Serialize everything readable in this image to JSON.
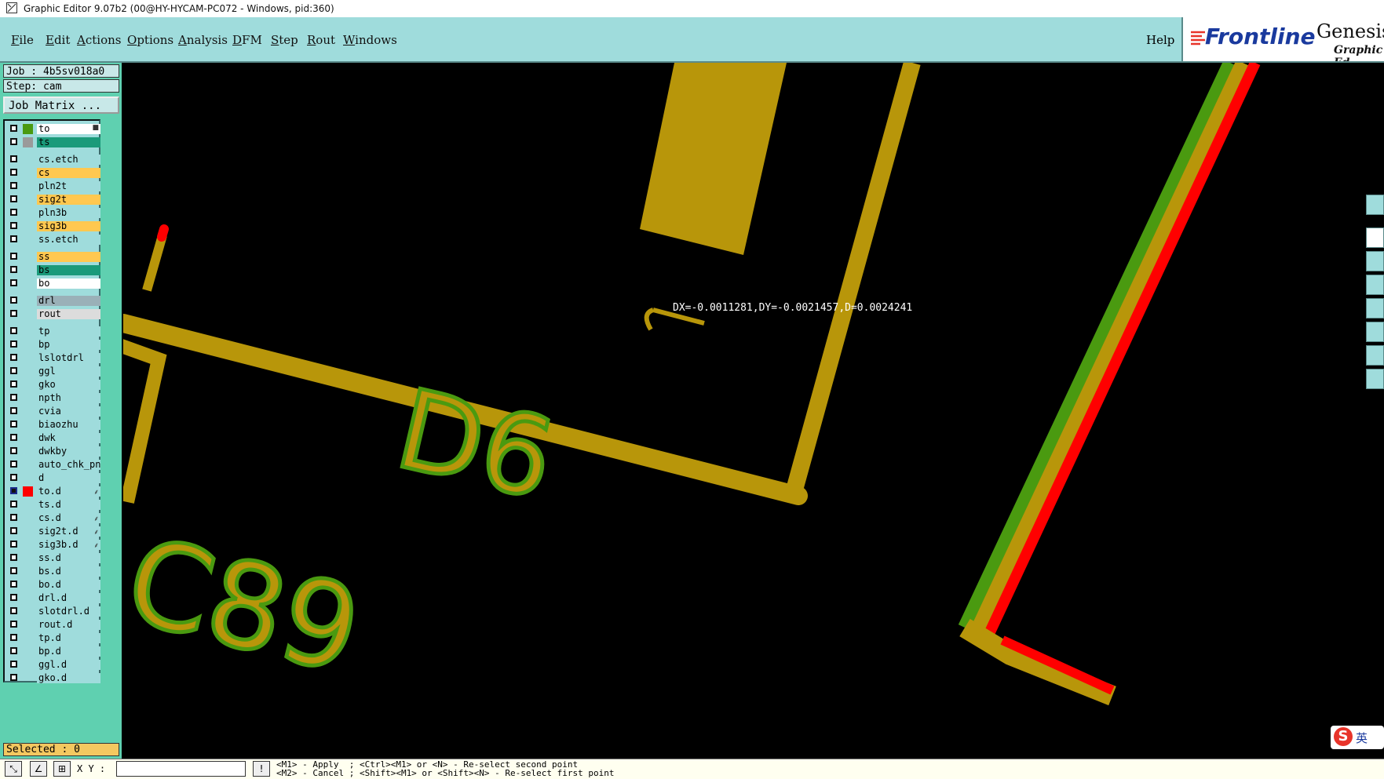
{
  "window": {
    "title": "Graphic Editor 9.07b2 (00@HY-HYCAM-PC072 - Windows, pid:360)"
  },
  "menu": {
    "file": "File",
    "edit": "Edit",
    "actions": "Actions",
    "options": "Options",
    "analysis": "Analysis",
    "dfm": "DFM",
    "step": "Step",
    "rout": "Rout",
    "windows": "Windows",
    "help": "Help"
  },
  "brand": {
    "logo": "Frontline",
    "product": "Genesis",
    "subtitle": "Graphic Ed"
  },
  "job": {
    "job_label": "Job : 4b5sv018a0",
    "step_label": "Step: cam",
    "matrix_button": "Job Matrix ..."
  },
  "colors": {
    "copper": "#b8960a",
    "silk_fill": "#b8960a",
    "silk_edge": "#4a9a10",
    "green_line": "#4a9a10",
    "red_line": "#ff0000",
    "panel": "#5fd0b0",
    "menubar": "#9fdcdc"
  },
  "layers": [
    {
      "name": "to",
      "color": "#4a9a10",
      "bg": "#ffffff",
      "checked": false,
      "mark": "■"
    },
    {
      "name": "ts",
      "color": "#9a9a9a",
      "bg": "#1a9a7a",
      "checked": false,
      "mark": ""
    },
    {
      "name": "cs.etch",
      "color": "",
      "bg": "#9fdcdc",
      "checked": false,
      "mark": "",
      "gap": true
    },
    {
      "name": "cs",
      "color": "",
      "bg": "#ffc850",
      "checked": false,
      "mark": ""
    },
    {
      "name": "pln2t",
      "color": "",
      "bg": "#9fdcdc",
      "checked": false,
      "mark": ""
    },
    {
      "name": "sig2t",
      "color": "",
      "bg": "#ffc850",
      "checked": false,
      "mark": ""
    },
    {
      "name": "pln3b",
      "color": "",
      "bg": "#9fdcdc",
      "checked": false,
      "mark": ""
    },
    {
      "name": "sig3b",
      "color": "",
      "bg": "#ffc850",
      "checked": false,
      "mark": ""
    },
    {
      "name": "ss.etch",
      "color": "",
      "bg": "#9fdcdc",
      "checked": false,
      "mark": ""
    },
    {
      "name": "ss",
      "color": "",
      "bg": "#ffc850",
      "checked": false,
      "mark": "",
      "gap": true
    },
    {
      "name": "bs",
      "color": "",
      "bg": "#1a9a7a",
      "checked": false,
      "mark": ""
    },
    {
      "name": "bo",
      "color": "",
      "bg": "#ffffff",
      "checked": false,
      "mark": ""
    },
    {
      "name": "drl",
      "color": "",
      "bg": "#9ab0b8",
      "checked": false,
      "mark": "",
      "gap": true
    },
    {
      "name": "rout",
      "color": "",
      "bg": "#dcdcdc",
      "checked": false,
      "mark": ""
    },
    {
      "name": "tp",
      "color": "",
      "bg": "#9fdcdc",
      "checked": false,
      "mark": "",
      "gap": true
    },
    {
      "name": "bp",
      "color": "",
      "bg": "#9fdcdc",
      "checked": false,
      "mark": ""
    },
    {
      "name": "lslotdrl",
      "color": "",
      "bg": "#9fdcdc",
      "checked": false,
      "mark": ""
    },
    {
      "name": "ggl",
      "color": "",
      "bg": "#9fdcdc",
      "checked": false,
      "mark": ""
    },
    {
      "name": "gko",
      "color": "",
      "bg": "#9fdcdc",
      "checked": false,
      "mark": ""
    },
    {
      "name": "npth",
      "color": "",
      "bg": "#9fdcdc",
      "checked": false,
      "mark": ""
    },
    {
      "name": "cvia",
      "color": "",
      "bg": "#9fdcdc",
      "checked": false,
      "mark": ""
    },
    {
      "name": "biaozhu",
      "color": "",
      "bg": "#9fdcdc",
      "checked": false,
      "mark": ""
    },
    {
      "name": "dwk",
      "color": "",
      "bg": "#9fdcdc",
      "checked": false,
      "mark": ""
    },
    {
      "name": "dwkby",
      "color": "",
      "bg": "#9fdcdc",
      "checked": false,
      "mark": ""
    },
    {
      "name": "auto_chk_pnl",
      "color": "",
      "bg": "#9fdcdc",
      "checked": false,
      "mark": ""
    },
    {
      "name": "d",
      "color": "",
      "bg": "#9fdcdc",
      "checked": false,
      "mark": ""
    },
    {
      "name": "to.d",
      "color": "#ff0000",
      "bg": "#9fdcdc",
      "checked": true,
      "mark": "⸙"
    },
    {
      "name": "ts.d",
      "color": "",
      "bg": "#9fdcdc",
      "checked": false,
      "mark": ""
    },
    {
      "name": "cs.d",
      "color": "",
      "bg": "#9fdcdc",
      "checked": false,
      "mark": "⸙"
    },
    {
      "name": "sig2t.d",
      "color": "",
      "bg": "#9fdcdc",
      "checked": false,
      "mark": "⸙"
    },
    {
      "name": "sig3b.d",
      "color": "",
      "bg": "#9fdcdc",
      "checked": false,
      "mark": "⸙"
    },
    {
      "name": "ss.d",
      "color": "",
      "bg": "#9fdcdc",
      "checked": false,
      "mark": ""
    },
    {
      "name": "bs.d",
      "color": "",
      "bg": "#9fdcdc",
      "checked": false,
      "mark": ""
    },
    {
      "name": "bo.d",
      "color": "",
      "bg": "#9fdcdc",
      "checked": false,
      "mark": ""
    },
    {
      "name": "drl.d",
      "color": "",
      "bg": "#9fdcdc",
      "checked": false,
      "mark": ""
    },
    {
      "name": "slotdrl.d",
      "color": "",
      "bg": "#9fdcdc",
      "checked": false,
      "mark": ""
    },
    {
      "name": "rout.d",
      "color": "",
      "bg": "#9fdcdc",
      "checked": false,
      "mark": ""
    },
    {
      "name": "tp.d",
      "color": "",
      "bg": "#9fdcdc",
      "checked": false,
      "mark": ""
    },
    {
      "name": "bp.d",
      "color": "",
      "bg": "#9fdcdc",
      "checked": false,
      "mark": ""
    },
    {
      "name": "ggl.d",
      "color": "",
      "bg": "#9fdcdc",
      "checked": false,
      "mark": ""
    },
    {
      "name": "gko.d",
      "color": "",
      "bg": "#9fdcdc",
      "checked": false,
      "mark": ""
    }
  ],
  "status": {
    "selected": "Selected : 0"
  },
  "canvas": {
    "measure_readout": "DX=-0.0011281,DY=-0.0021457,D=0.0024241",
    "silk_text_1": "D6",
    "silk_text_2": "C89"
  },
  "bottom": {
    "xy_label": "X Y :",
    "msg_line1": "<M1> - Apply  ; <Ctrl><M1> or <N> - Re-select second point",
    "msg_line2": "<M2> - Cancel ; <Shift><M1> or <Shift><N> - Re-select first point"
  },
  "icons": {
    "app": "graphic-editor-icon",
    "ime": "sogou-ime-icon"
  },
  "ime": {
    "letter": "S",
    "lang": "英"
  }
}
